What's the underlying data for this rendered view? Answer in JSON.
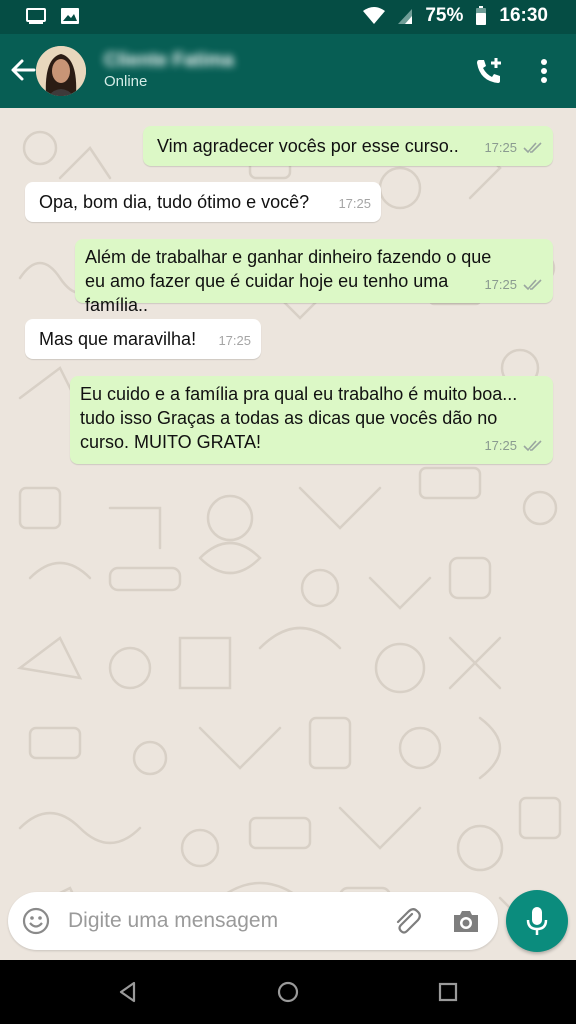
{
  "status_bar": {
    "battery_percent": "75%",
    "time": "16:30",
    "icons": [
      "screen-cast-icon",
      "image-icon",
      "wifi-icon",
      "signal-icon",
      "battery-icon"
    ]
  },
  "header": {
    "contact_name": "Cliente Fatima",
    "contact_status": "Online",
    "icons": [
      "back-arrow-icon",
      "add-call-icon",
      "more-vert-icon"
    ]
  },
  "messages": [
    {
      "direction": "out",
      "text": "Vim agradecer vocês por esse curso..",
      "time": "17:25",
      "read": true
    },
    {
      "direction": "in",
      "text": "Opa, bom dia, tudo ótimo e você?",
      "time": "17:25"
    },
    {
      "direction": "out",
      "text": "Além de trabalhar e ganhar dinheiro fazendo o que eu amo fazer que é cuidar hoje eu tenho uma família..",
      "time": "17:25",
      "read": true
    },
    {
      "direction": "in",
      "text": "Mas que maravilha!",
      "time": "17:25"
    },
    {
      "direction": "out",
      "text": "Eu cuido e a família pra qual eu trabalho é muito boa... tudo isso Graças a todas as dicas que vocês dão no curso. MUITO GRATA!",
      "time": "17:25",
      "read": true
    }
  ],
  "composer": {
    "placeholder": "Digite uma mensagem",
    "value": "",
    "icons": [
      "emoji-icon",
      "attach-icon",
      "camera-icon",
      "mic-icon"
    ]
  },
  "colors": {
    "header": "#075e54",
    "status_bar": "#054d44",
    "outgoing_bubble": "#dcf8c6",
    "incoming_bubble": "#ffffff",
    "chat_background": "#ece5dd",
    "mic_button": "#0b8c7d"
  }
}
